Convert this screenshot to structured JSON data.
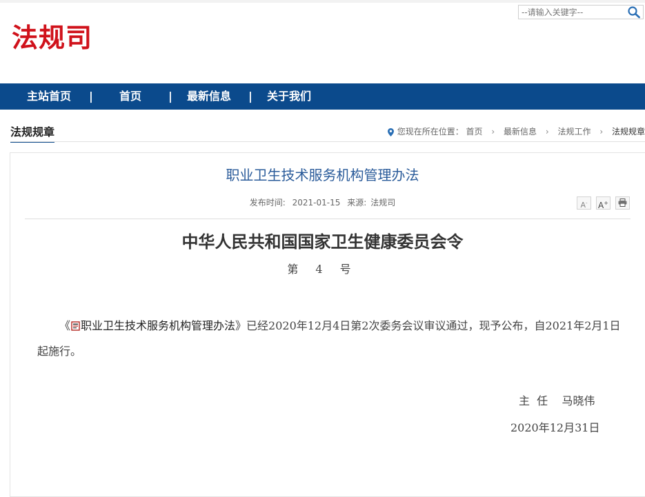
{
  "site": {
    "logo": "法规司"
  },
  "search": {
    "placeholder": "--请输入关键字--"
  },
  "nav": {
    "items": [
      "主站首页",
      "首页",
      "最新信息",
      "关于我们"
    ],
    "separator": "|"
  },
  "section": {
    "title": "法规规章"
  },
  "breadcrumb": {
    "prefix": "您现在所在位置：",
    "items": [
      "首页",
      "最新信息",
      "法规工作",
      "法规规章"
    ]
  },
  "article": {
    "title": "职业卫生技术服务机构管理办法",
    "publish_label": "发布时间:",
    "publish_date": "2021-01-15",
    "source_label": "来源:",
    "source": "法规司",
    "tools": {
      "font_smaller": "A",
      "font_larger": "A",
      "print": "print"
    }
  },
  "order": {
    "title": "中华人民共和国国家卫生健康委员会令",
    "number": "第 4 号",
    "body_open": "《",
    "body_link": "职业卫生技术服务机构管理办法",
    "body_rest": "》已经2020年12月4日第2次委务会议审议通过，现予公布，自2021年2月1日起施行。",
    "signature_title": "主  任",
    "signature_name": "马晓伟",
    "date": "2020年12月31日"
  },
  "colors": {
    "brand_red": "#d0121b",
    "nav_blue": "#0b4a8c",
    "title_blue": "#2a5b9a"
  },
  "icons": [
    "search-icon",
    "location-pin-icon",
    "book-icon",
    "font-decrease-icon",
    "font-increase-icon",
    "print-icon"
  ]
}
